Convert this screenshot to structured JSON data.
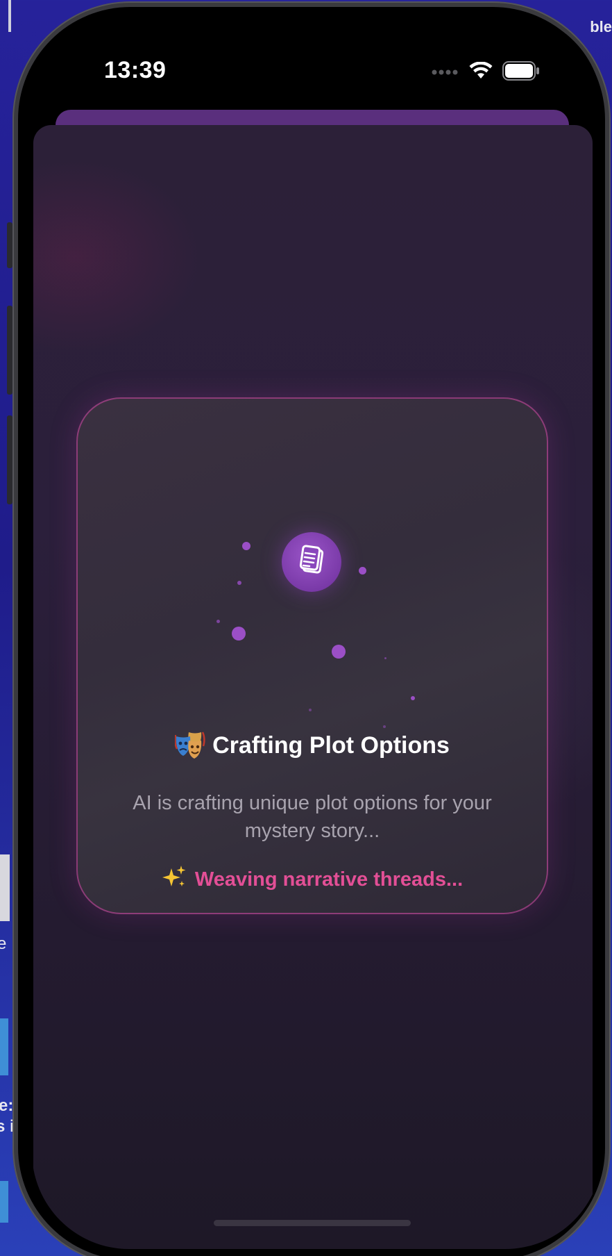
{
  "desktop": {
    "top_right_fragment": "ble",
    "left_fragment_1": "e",
    "left_fragment_2": "e:",
    "left_fragment_3": "s i"
  },
  "status_bar": {
    "time": "13:39",
    "icons": [
      "cellular-dots-icon",
      "wifi-icon",
      "battery-icon"
    ]
  },
  "loading_card": {
    "title_emoji": "performing-arts-icon",
    "title": "Crafting Plot Options",
    "subtitle": "AI is crafting unique plot options for your mystery story...",
    "status_emoji": "sparkles-icon",
    "status_text": "Weaving narrative threads...",
    "center_icon": "document-icon"
  },
  "colors": {
    "accent_purple": "#8e44c4",
    "status_pink": "#e34f96",
    "card_border": "#c846a0",
    "sheet_background": "#2b1f3b"
  }
}
